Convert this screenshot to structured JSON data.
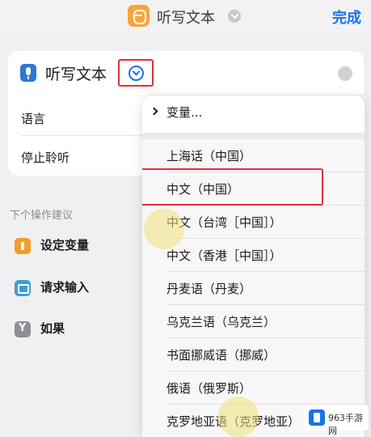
{
  "topbar": {
    "title": "听写文本",
    "done_label": "完成"
  },
  "action": {
    "title": "听写文本",
    "icon": "microphone-icon"
  },
  "parameters": {
    "language_label": "语言",
    "stop_label": "停止聆听"
  },
  "suggestions": {
    "heading": "下个操作建议",
    "items": [
      {
        "label": "设定变量",
        "icon": "variable-icon"
      },
      {
        "label": "请求输入",
        "icon": "input-icon"
      },
      {
        "label": "如果",
        "icon": "if-icon"
      }
    ]
  },
  "menu": {
    "variables_label": "变量...",
    "items": [
      {
        "label": "上海话（中国）"
      },
      {
        "label": "中文（中国）"
      },
      {
        "label": "中文（台湾［中国］）"
      },
      {
        "label": "中文（香港［中国］）"
      },
      {
        "label": "丹麦语（丹麦）"
      },
      {
        "label": "乌克兰语（乌克兰）"
      },
      {
        "label": "书面挪威语（挪威）"
      },
      {
        "label": "俄语（俄罗斯）"
      },
      {
        "label": "克罗地亚语（克罗地亚）"
      }
    ],
    "selected_index": 1
  },
  "watermark": {
    "text": "963手游网"
  },
  "colors": {
    "accent": "#1a73e8",
    "highlight_red": "#d9323c",
    "app_orange": "#f6a53b"
  }
}
